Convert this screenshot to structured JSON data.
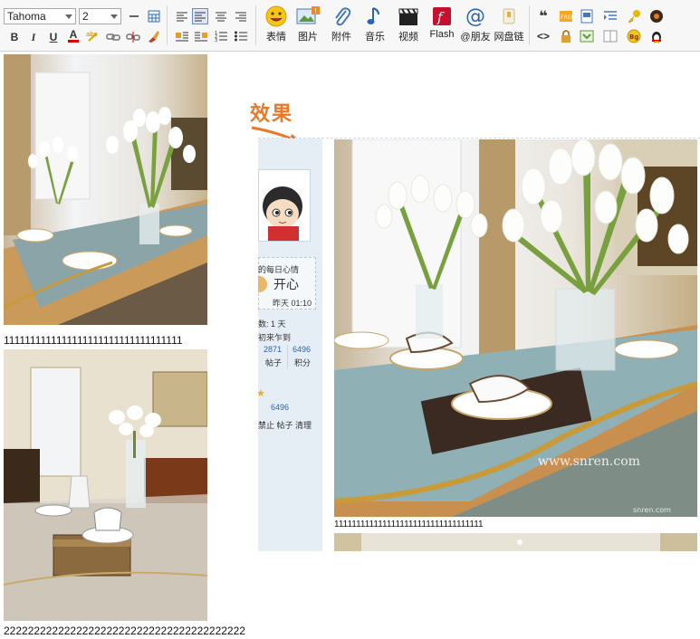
{
  "toolbar": {
    "font_name": "Tahoma",
    "font_size": "2",
    "buttons": {
      "smilies": "表情",
      "image": "图片",
      "attachment": "附件",
      "music": "音乐",
      "video": "视频",
      "flash": "Flash",
      "at_friend": "@朋友",
      "netdisk": "网盘链"
    },
    "format": {
      "bold": "B",
      "italic": "I",
      "underline": "U",
      "font_color": "A",
      "code": "<>",
      "quote": "❝"
    }
  },
  "content": {
    "line1": "1111111111111111111111111111111111",
    "line2": "2222222222222222222222222222222222222222",
    "effect_label": "效果",
    "demo_line": "1111111111111111111111111111111111",
    "watermark": "www.snren.com",
    "watermark_small": "snren.com"
  },
  "profile": {
    "mood_title": "的每日心情",
    "mood": "开心",
    "mood_time": "昨天 01:10",
    "days": "数: 1 天",
    "checkin": "初来乍到",
    "posts": "2871",
    "posts_label": "帖子",
    "points": "6496",
    "points_label": "积分",
    "points2": "6496",
    "actions": "禁止 帖子 清理"
  },
  "colors": {
    "accent": "#e8792a",
    "link": "#2a66b0",
    "sidebar": "#e5edf5"
  }
}
